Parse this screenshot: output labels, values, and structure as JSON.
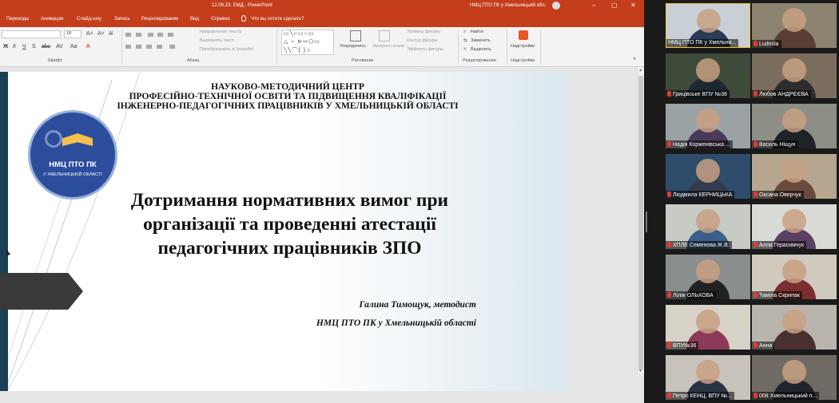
{
  "titlebar": {
    "doc_title": "12.09.23. ЕМД  -  PowerPoint",
    "user_name": "НМЦ ПТО ПК у Хмельницькій обл.",
    "minimize": "–",
    "restore": "▢",
    "close": "✕"
  },
  "ribbon_tabs": [
    "Переходы",
    "Анимации",
    "Слайд-шоу",
    "Запись",
    "Рецензирование",
    "Вид",
    "Справка"
  ],
  "tell_me": "Что вы хотите сделать?",
  "ribbon": {
    "groups": [
      "Шрифт",
      "Абзац",
      "Рисование",
      "Редактирование",
      "Надстройки"
    ],
    "font_size": "18",
    "paragraph": {
      "text_direction": "Направление текста",
      "align_text": "Выровнять текст",
      "smartart": "Преобразовать в SmartArt"
    },
    "drawing": {
      "arrange": "Упорядочить",
      "quick_styles": "Экспресс-стили",
      "fill": "Заливка фигуры",
      "outline": "Контур фигуры",
      "effects": "Эффекты фигуры"
    },
    "editing": {
      "find": "Найти",
      "replace": "Заменить",
      "select": "Выделить"
    },
    "addins": "Надстройки"
  },
  "slide": {
    "org_lines": [
      "НАУКОВО-МЕТОДИЧНИЙ ЦЕНТР",
      "ПРОФЕСІЙНО-ТЕХНІЧНОЇ ОСВІТИ   ТА ПІДВИЩЕННЯ КВАЛІФІКАЦІЇ",
      "ІНЖЕНЕРНО-ПЕДАГОГІЧНИХ ПРАЦІВНИКІВ У ХМЕЛЬНИЦЬКІЙ ОБЛАСТІ"
    ],
    "logo_line1": "НМЦ ПТО ПК",
    "logo_line2": "У ХМЕЛЬНИЦЬКІЙ ОБЛАСТІ",
    "title_lines": [
      "Дотримання нормативних вимог при",
      "організації та проведенні атестації",
      "педагогічних працівників ЗПО"
    ],
    "author": "Галина  Тимощук, методист",
    "author_org": "НМЦ ПТО ПК у Хмельницькій області"
  },
  "participants": [
    {
      "name": "НМЦ ПТО ПК у Хмельни...",
      "muted": false
    },
    {
      "name": "Ludmila",
      "muted": true
    },
    {
      "name": "Грицівське ВПУ №38",
      "muted": true
    },
    {
      "name": "Любов АНДРЄЄВА",
      "muted": true
    },
    {
      "name": "Надія Корженівська ...",
      "muted": true
    },
    {
      "name": "Василь Ніщун",
      "muted": true
    },
    {
      "name": "Людмила КЕРНИЦЬКА",
      "muted": true
    },
    {
      "name": "Оксана Оверчук",
      "muted": true
    },
    {
      "name": "ХПЛЕ  Семенова Ж.В.",
      "muted": true
    },
    {
      "name": "Алла Герасимчук",
      "muted": true
    },
    {
      "name": "Лілія ОЛЬХОВА",
      "muted": true
    },
    {
      "name": "Таміла Скрипак",
      "muted": true
    },
    {
      "name": "ВПУ№36",
      "muted": true
    },
    {
      "name": "Анна",
      "muted": true
    },
    {
      "name": "Петро КЕНЦ, ВПУ №...",
      "muted": true
    },
    {
      "name": "008 Хмельницький п...",
      "muted": true
    }
  ]
}
